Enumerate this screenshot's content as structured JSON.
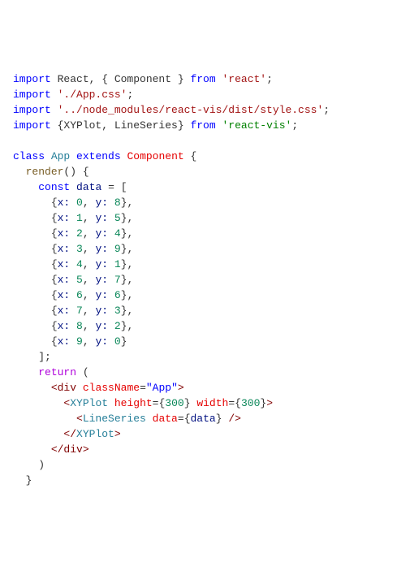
{
  "code": {
    "imports": [
      {
        "kw_import": "import",
        "what_full": " React, { Component } ",
        "kw_from": "from",
        "path": "'react'",
        "semi": ";"
      },
      {
        "kw_import": "import",
        "path": " './App.css'",
        "semi": ";"
      },
      {
        "kw_import": "import",
        "path": " '../node_modules/react-vis/dist/style.css'",
        "semi": ";"
      },
      {
        "kw_import": "import",
        "what_full": " {XYPlot, LineSeries} ",
        "kw_from": "from",
        "path": "'react-vis'",
        "semi": ";"
      }
    ],
    "class_decl": {
      "kw_class": "class",
      "class_name": "App",
      "kw_extends": "extends",
      "super_name": "Component",
      "brace_open": "{"
    },
    "render_decl": {
      "fn_name": "render",
      "parens": "()",
      "brace_open": "{"
    },
    "const_decl": {
      "kw_const": "const",
      "var_name": "data",
      "equals": "=",
      "bracket_open": "["
    },
    "data_points": [
      {
        "x_key": "x:",
        "x": "0",
        "y_key": "y:",
        "y": "8",
        "comma": ","
      },
      {
        "x_key": "x:",
        "x": "1",
        "y_key": "y:",
        "y": "5",
        "comma": ","
      },
      {
        "x_key": "x:",
        "x": "2",
        "y_key": "y:",
        "y": "4",
        "comma": ","
      },
      {
        "x_key": "x:",
        "x": "3",
        "y_key": "y:",
        "y": "9",
        "comma": ","
      },
      {
        "x_key": "x:",
        "x": "4",
        "y_key": "y:",
        "y": "1",
        "comma": ","
      },
      {
        "x_key": "x:",
        "x": "5",
        "y_key": "y:",
        "y": "7",
        "comma": ","
      },
      {
        "x_key": "x:",
        "x": "6",
        "y_key": "y:",
        "y": "6",
        "comma": ","
      },
      {
        "x_key": "x:",
        "x": "7",
        "y_key": "y:",
        "y": "3",
        "comma": ","
      },
      {
        "x_key": "x:",
        "x": "8",
        "y_key": "y:",
        "y": "2",
        "comma": ","
      },
      {
        "x_key": "x:",
        "x": "9",
        "y_key": "y:",
        "y": "0",
        "comma": ""
      }
    ],
    "bracket_close": "];",
    "return_stmt": {
      "kw_return": "return",
      "paren_open": "("
    },
    "jsx": {
      "div_open_lt": "<",
      "div_tag": "div",
      "div_attr": "className",
      "div_eq": "=",
      "div_val": "\"App\"",
      "div_open_gt": ">",
      "xy_open_lt": "<",
      "xy_tag": "XYPlot",
      "xy_h_attr": "height",
      "xy_h_eq": "=",
      "xy_h_bo": "{",
      "xy_h_val": "300",
      "xy_h_bc": "}",
      "xy_w_attr": "width",
      "xy_w_eq": "=",
      "xy_w_bo": "{",
      "xy_w_val": "300",
      "xy_w_bc": "}",
      "xy_open_gt": ">",
      "ls_open_lt": "<",
      "ls_tag": "LineSeries",
      "ls_attr": "data",
      "ls_eq": "=",
      "ls_bo": "{",
      "ls_val": "data",
      "ls_bc": "}",
      "ls_close": " />",
      "xy_close_lt": "</",
      "xy_close_tag": "XYPlot",
      "xy_close_gt": ">",
      "div_close_lt": "</",
      "div_close_tag": "div",
      "div_close_gt": ">"
    },
    "paren_close": ")",
    "brace_close1": "}",
    "brace_close2": "}"
  },
  "chart_data": {
    "type": "line",
    "title": "",
    "xlabel": "",
    "ylabel": "",
    "categories": [
      0,
      1,
      2,
      3,
      4,
      5,
      6,
      7,
      8,
      9
    ],
    "values": [
      8,
      5,
      4,
      9,
      1,
      7,
      6,
      3,
      2,
      0
    ],
    "xlim": [
      0,
      9
    ],
    "ylim": [
      0,
      9
    ]
  }
}
